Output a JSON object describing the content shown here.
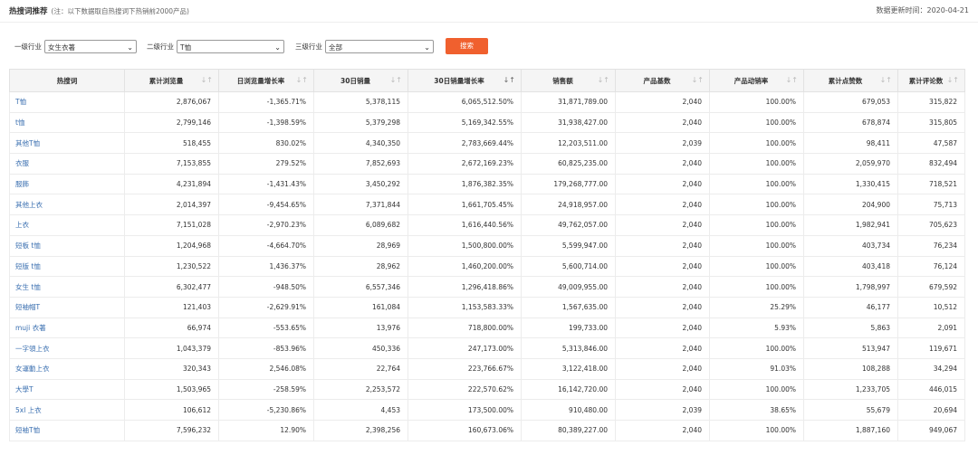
{
  "header": {
    "title": "热搜词推荐",
    "note": "(注：以下数据取自热搜词下热销前2000产品)",
    "update": "数据更新时间：2020-04-21"
  },
  "filters": {
    "level1_label": "一级行业",
    "level1_value": "女生衣著",
    "level2_label": "二级行业",
    "level2_value": "T恤",
    "level3_label": "三级行业",
    "level3_value": "全部",
    "search_label": "搜索"
  },
  "table": {
    "columns": [
      {
        "label": "热搜词",
        "sortable": false
      },
      {
        "label": "累计浏览量",
        "sortable": true
      },
      {
        "label": "日浏览量增长率",
        "sortable": true
      },
      {
        "label": "30日销量",
        "sortable": true
      },
      {
        "label": "30日销量增长率",
        "sortable": true,
        "active": true
      },
      {
        "label": "销售额",
        "sortable": true
      },
      {
        "label": "产品基数",
        "sortable": true
      },
      {
        "label": "产品动销率",
        "sortable": true
      },
      {
        "label": "累计点赞数",
        "sortable": true
      },
      {
        "label": "累计评论数",
        "sortable": true
      }
    ],
    "sort_icon": "↓↑",
    "rows": [
      [
        "T恤",
        "2,876,067",
        "-1,365.71%",
        "5,378,115",
        "6,065,512.50%",
        "31,871,789.00",
        "2,040",
        "100.00%",
        "679,053",
        "315,822"
      ],
      [
        "t恤",
        "2,799,146",
        "-1,398.59%",
        "5,379,298",
        "5,169,342.55%",
        "31,938,427.00",
        "2,040",
        "100.00%",
        "678,874",
        "315,805"
      ],
      [
        "其他T恤",
        "518,455",
        "830.02%",
        "4,340,350",
        "2,783,669.44%",
        "12,203,511.00",
        "2,039",
        "100.00%",
        "98,411",
        "47,587"
      ],
      [
        "衣服",
        "7,153,855",
        "279.52%",
        "7,852,693",
        "2,672,169.23%",
        "60,825,235.00",
        "2,040",
        "100.00%",
        "2,059,970",
        "832,494"
      ],
      [
        "服飾",
        "4,231,894",
        "-1,431.43%",
        "3,450,292",
        "1,876,382.35%",
        "179,268,777.00",
        "2,040",
        "100.00%",
        "1,330,415",
        "718,521"
      ],
      [
        "其他上衣",
        "2,014,397",
        "-9,454.65%",
        "7,371,844",
        "1,661,705.45%",
        "24,918,957.00",
        "2,040",
        "100.00%",
        "204,900",
        "75,713"
      ],
      [
        "上衣",
        "7,151,028",
        "-2,970.23%",
        "6,089,682",
        "1,616,440.56%",
        "49,762,057.00",
        "2,040",
        "100.00%",
        "1,982,941",
        "705,623"
      ],
      [
        "短板 t恤",
        "1,204,968",
        "-4,664.70%",
        "28,969",
        "1,500,800.00%",
        "5,599,947.00",
        "2,040",
        "100.00%",
        "403,734",
        "76,234"
      ],
      [
        "短版 t恤",
        "1,230,522",
        "1,436.37%",
        "28,962",
        "1,460,200.00%",
        "5,600,714.00",
        "2,040",
        "100.00%",
        "403,418",
        "76,124"
      ],
      [
        "女生 t恤",
        "6,302,477",
        "-948.50%",
        "6,557,346",
        "1,296,418.86%",
        "49,009,955.00",
        "2,040",
        "100.00%",
        "1,798,997",
        "679,592"
      ],
      [
        "短袖帽T",
        "121,403",
        "-2,629.91%",
        "161,084",
        "1,153,583.33%",
        "1,567,635.00",
        "2,040",
        "25.29%",
        "46,177",
        "10,512"
      ],
      [
        "muji 衣著",
        "66,974",
        "-553.65%",
        "13,976",
        "718,800.00%",
        "199,733.00",
        "2,040",
        "5.93%",
        "5,863",
        "2,091"
      ],
      [
        "一字領上衣",
        "1,043,379",
        "-853.96%",
        "450,336",
        "247,173.00%",
        "5,313,846.00",
        "2,040",
        "100.00%",
        "513,947",
        "119,671"
      ],
      [
        "女運動上衣",
        "320,343",
        "2,546.08%",
        "22,764",
        "223,766.67%",
        "3,122,418.00",
        "2,040",
        "91.03%",
        "108,288",
        "34,294"
      ],
      [
        "大學T",
        "1,503,965",
        "-258.59%",
        "2,253,572",
        "222,570.62%",
        "16,142,720.00",
        "2,040",
        "100.00%",
        "1,233,705",
        "446,015"
      ],
      [
        "5xl 上衣",
        "106,612",
        "-5,230.86%",
        "4,453",
        "173,500.00%",
        "910,480.00",
        "2,039",
        "38.65%",
        "55,679",
        "20,694"
      ],
      [
        "短袖T恤",
        "7,596,232",
        "12.90%",
        "2,398,256",
        "160,673.06%",
        "80,389,227.00",
        "2,040",
        "100.00%",
        "1,887,160",
        "949,067"
      ]
    ]
  },
  "colors": {
    "accent": "#f0602e",
    "link": "#3a6fb0",
    "header_bg": "#f5f5f5"
  }
}
